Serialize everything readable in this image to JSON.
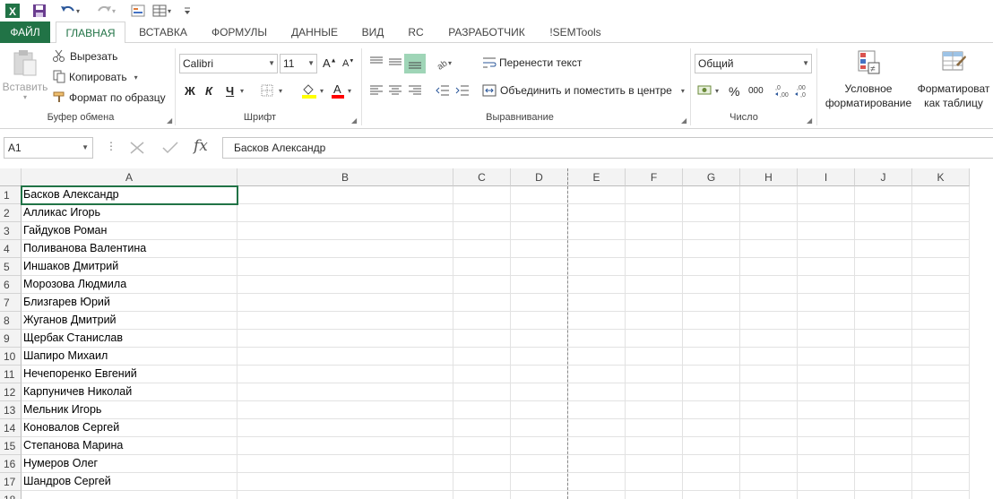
{
  "qat": {
    "icons": [
      "excel-logo-icon",
      "save-icon",
      "undo-icon",
      "redo-icon",
      "form-icon",
      "customize-icon"
    ]
  },
  "tabs": [
    {
      "label": "ФАЙЛ"
    },
    {
      "label": "ГЛАВНАЯ"
    },
    {
      "label": "ВСТАВКА"
    },
    {
      "label": "ФОРМУЛЫ"
    },
    {
      "label": "ДАННЫЕ"
    },
    {
      "label": "ВИД"
    },
    {
      "label": "RC"
    },
    {
      "label": "РАЗРАБОТЧИК"
    },
    {
      "label": "!SEMTools"
    }
  ],
  "ribbon": {
    "clipboard": {
      "paste": "Вставить",
      "cut": "Вырезать",
      "copy": "Копировать",
      "format_painter": "Формат по образцу",
      "group": "Буфер обмена"
    },
    "font": {
      "name": "Calibri",
      "size": "11",
      "bold": "Ж",
      "italic": "К",
      "underline": "Ч",
      "group": "Шрифт"
    },
    "alignment": {
      "wrap": "Перенести текст",
      "merge": "Объединить и поместить в центре",
      "group": "Выравнивание"
    },
    "number": {
      "format": "Общий",
      "percent": "%",
      "thousands": "000",
      "group": "Число"
    },
    "styles": {
      "conditional_1": "Условное",
      "conditional_2": "форматирование",
      "table_1": "Форматироват",
      "table_2": "как таблицу"
    }
  },
  "formula_bar": {
    "name_box": "A1",
    "fx": "fx",
    "value": "Басков Александр"
  },
  "columns": [
    "A",
    "B",
    "C",
    "D",
    "E",
    "F",
    "G",
    "H",
    "I",
    "J",
    "K"
  ],
  "rows": [
    {
      "n": "1",
      "a": "Басков Александр"
    },
    {
      "n": "2",
      "a": "Алликас Игорь"
    },
    {
      "n": "3",
      "a": "Гайдуков Роман"
    },
    {
      "n": "4",
      "a": "Поливанова Валентина"
    },
    {
      "n": "5",
      "a": "Иншаков Дмитрий"
    },
    {
      "n": "6",
      "a": "Морозова Людмила"
    },
    {
      "n": "7",
      "a": "Близгарев Юрий"
    },
    {
      "n": "8",
      "a": "Жуганов Дмитрий"
    },
    {
      "n": "9",
      "a": "Щербак Станислав"
    },
    {
      "n": "10",
      "a": "Шапиро Михаил"
    },
    {
      "n": "11",
      "a": "Нечепоренко Евгений"
    },
    {
      "n": "12",
      "a": "Карпуничев Николай"
    },
    {
      "n": "13",
      "a": "Мельник Игорь"
    },
    {
      "n": "14",
      "a": "Коновалов Сергей"
    },
    {
      "n": "15",
      "a": "Степанова Марина"
    },
    {
      "n": "16",
      "a": "Нумеров Олег"
    },
    {
      "n": "17",
      "a": "Шандров Сергей"
    },
    {
      "n": "18",
      "a": ""
    }
  ],
  "colors": {
    "accent": "#217346",
    "fill_yellow": "#ffff00",
    "font_red": "#ff0000"
  }
}
